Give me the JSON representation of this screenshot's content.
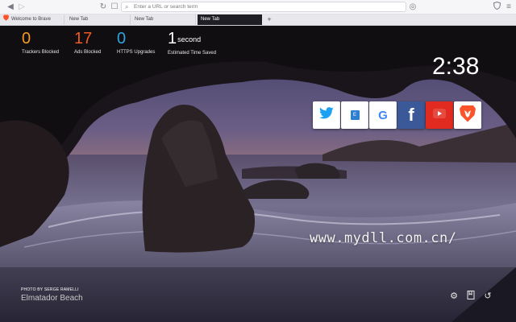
{
  "toolbar": {
    "back_icon": "back-arrow-icon",
    "forward_icon": "forward-arrow-icon",
    "reload_icon": "reload-icon",
    "bookmark_icon": "bookmark-icon",
    "url_placeholder": "Enter a URL or search term"
  },
  "tabs": [
    {
      "label": "Welcome to Brave",
      "active": false
    },
    {
      "label": "New Tab",
      "active": false
    },
    {
      "label": "New Tab",
      "active": false
    },
    {
      "label": "New Tab",
      "active": true
    }
  ],
  "new_tab_symbol": "+",
  "stats": [
    {
      "value": "0",
      "label": "Trackers Blocked",
      "color": "#f49b1f"
    },
    {
      "value": "17",
      "label": "Ads Blocked",
      "color": "#ee5a24"
    },
    {
      "value": "0",
      "label": "HTTPS Upgrades",
      "color": "#2ea4e0"
    },
    {
      "value": "1",
      "unit": "second",
      "label": "Estimated Time Saved",
      "color": "#ffffff"
    }
  ],
  "clock": "2:38",
  "top_sites": [
    {
      "name": "twitter",
      "icon": "twitter-icon",
      "color": "#1da1f2"
    },
    {
      "name": "e",
      "icon": "e-icon",
      "color": "#2f7fd1",
      "glyph": "E"
    },
    {
      "name": "google",
      "icon": "google-icon",
      "color": "#4285f4",
      "glyph": "G"
    },
    {
      "name": "facebook",
      "icon": "facebook-icon",
      "color": "#3b5998",
      "glyph": "f"
    },
    {
      "name": "youtube",
      "icon": "youtube-icon",
      "color": "#e22b20"
    },
    {
      "name": "brave",
      "icon": "brave-lion-icon",
      "color": "#fb542b"
    }
  ],
  "watermark": "www.mydll.com.cn/",
  "photo_credit": {
    "by": "PHOTO BY SERGE RAMELLI",
    "place": "Elmatador Beach"
  },
  "footer_icons": [
    "settings-icon",
    "bookmarks-icon",
    "history-icon"
  ]
}
